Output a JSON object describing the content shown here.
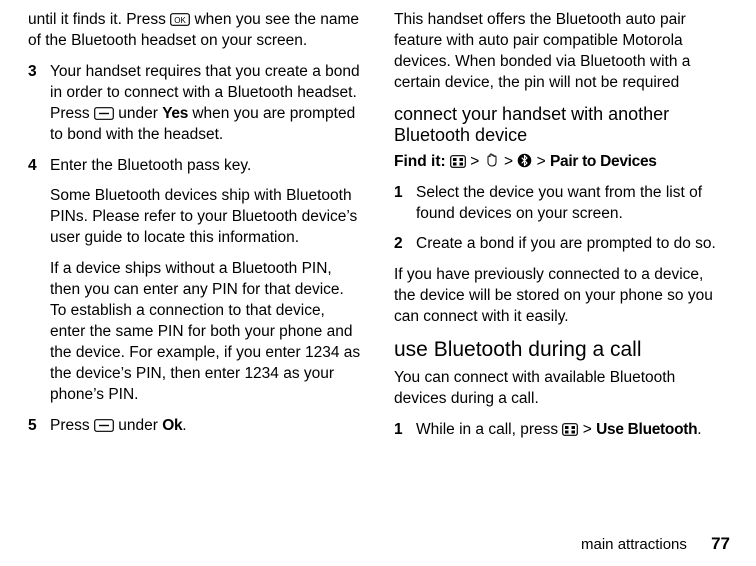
{
  "left": {
    "intro": {
      "a": "until it finds it. Press ",
      "b": " when you see the name of the Bluetooth headset on your screen."
    },
    "step3": {
      "num": "3",
      "a": "Your handset requires that you create a bond in order to connect with a Bluetooth headset. Press ",
      "b": " under ",
      "yes": "Yes",
      "c": " when you are prompted to bond with the headset."
    },
    "step4": {
      "num": "4",
      "a": "Enter the Bluetooth pass key.",
      "b": "Some Bluetooth devices ship with Bluetooth PINs. Please refer to your Bluetooth device’s user guide to locate this information.",
      "c": "If a device ships without a Bluetooth PIN, then you can enter any PIN for that device. To establish a connection to that device, enter the same PIN for both your phone and the device. For example, if you enter 1234 as the device’s PIN, then enter 1234 as your phone’s PIN."
    },
    "step5": {
      "num": "5",
      "a": "Press ",
      "b": " under ",
      "ok": "Ok",
      "dot": "."
    }
  },
  "right": {
    "intro": "This handset offers the Bluetooth auto pair feature with auto pair compatible Motorola devices. When bonded via Bluetooth with a certain device, the pin will not be required",
    "h_connect": "connect your handset with another Bluetooth device",
    "findit": {
      "label": "Find it: ",
      "gt1": " > ",
      "gt2": " > ",
      "gt3": " > ",
      "pair": "Pair to Devices"
    },
    "step1": {
      "num": "1",
      "a": "Select the device you want from the list of found devices on your screen."
    },
    "step2": {
      "num": "2",
      "a": "Create a bond if you are prompted to do so."
    },
    "prev": "If you have previously connected to a device, the device will be stored on your phone so you can connect with it easily.",
    "h_call": "use Bluetooth during a call",
    "call_desc": "You can connect with available Bluetooth devices during a call.",
    "cstep1": {
      "num": "1",
      "a": "While in a call, press ",
      "gt": " > ",
      "usebt": "Use Bluetooth",
      "dot": "."
    }
  },
  "footer": {
    "section": "main attractions",
    "page": "77"
  }
}
